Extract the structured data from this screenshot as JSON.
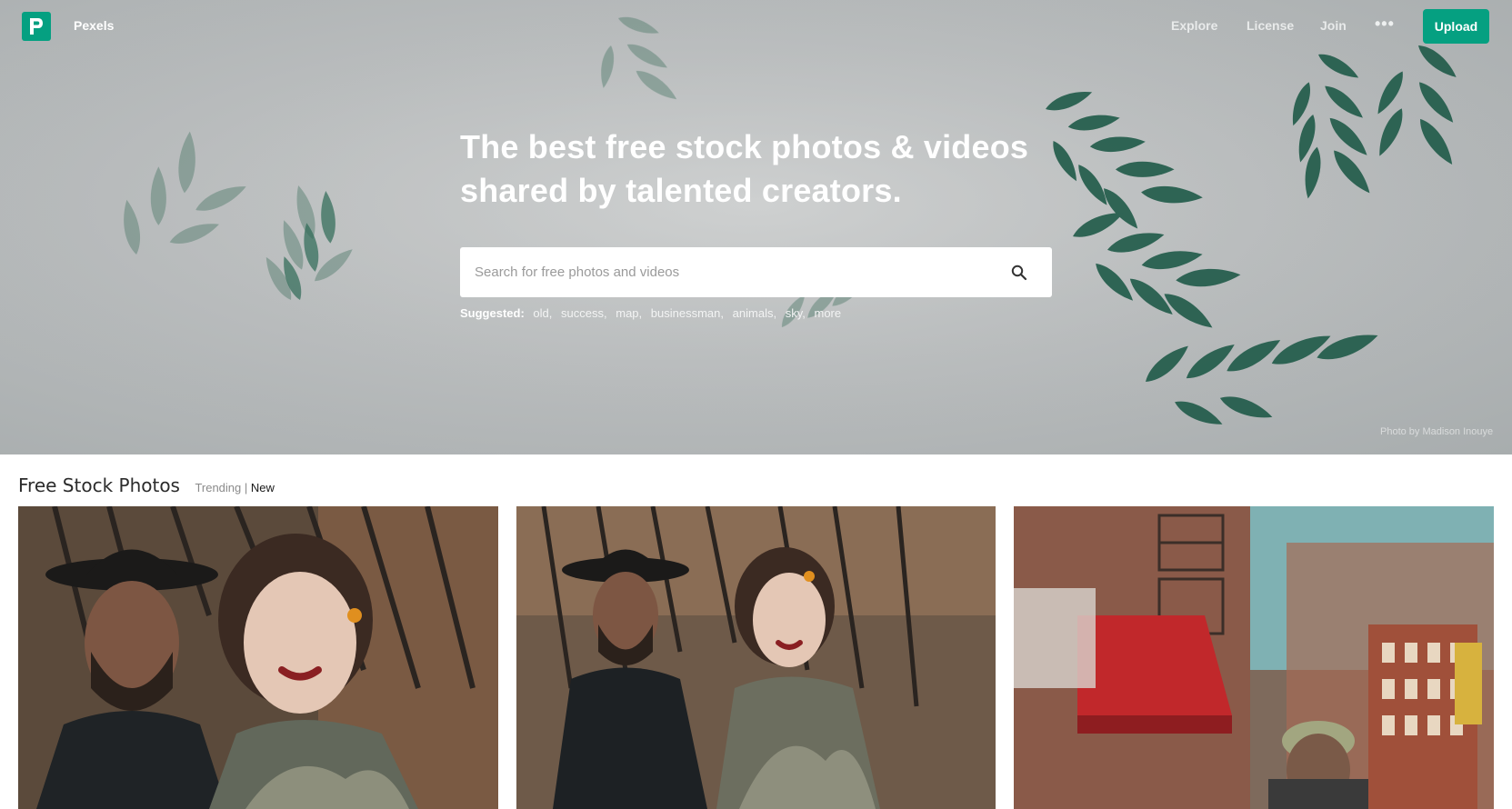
{
  "brand": {
    "name": "Pexels",
    "accent": "#05a081"
  },
  "nav": {
    "links": [
      "Explore",
      "License",
      "Join"
    ],
    "more_label": "•••",
    "upload_label": "Upload"
  },
  "hero": {
    "headline": "The best free stock photos & videos shared by talented creators.",
    "search": {
      "placeholder": "Search for free photos and videos",
      "value": ""
    },
    "suggested_label": "Suggested:",
    "suggested_tags": [
      "old",
      "success",
      "map",
      "businessman",
      "animals",
      "sky",
      "more"
    ],
    "photo_credit": "Photo by Madison Inouye"
  },
  "feed": {
    "title": "Free Stock Photos",
    "filter_trending": "Trending",
    "filter_separator": "|",
    "filter_new": "New",
    "active_filter": "New"
  },
  "icons": {
    "logo": "pexels-logo-icon",
    "more": "ellipsis-icon",
    "search": "search-icon"
  }
}
